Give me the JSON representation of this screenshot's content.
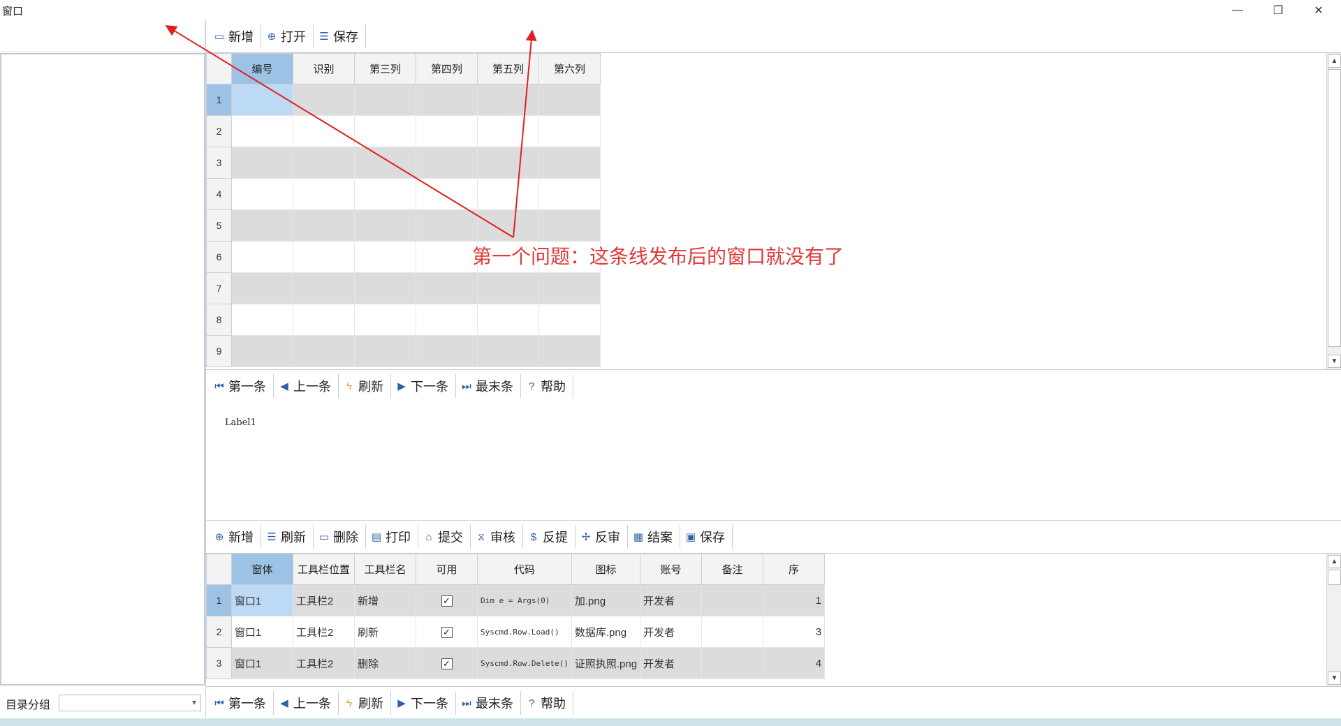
{
  "window": {
    "title": "窗口",
    "minimize": "—",
    "restore": "❐",
    "close": "✕"
  },
  "left": {
    "group_label": "目录分组",
    "combo_value": ""
  },
  "top_toolbar": [
    {
      "name": "add",
      "label": "新增",
      "icon": "▭"
    },
    {
      "name": "open",
      "label": "打开",
      "icon": "⊕"
    },
    {
      "name": "save",
      "label": "保存",
      "icon": "☰"
    }
  ],
  "grid1": {
    "columns": [
      "编号",
      "识别",
      "第三列",
      "第四列",
      "第五列",
      "第六列"
    ],
    "rows": [
      "1",
      "2",
      "3",
      "4",
      "5",
      "6",
      "7",
      "8",
      "9"
    ]
  },
  "nav_toolbar": [
    {
      "name": "first",
      "label": "第一条",
      "icon": "⏮"
    },
    {
      "name": "prev",
      "label": "上一条",
      "icon": "◀"
    },
    {
      "name": "refresh",
      "label": "刷新",
      "icon": "ϟ"
    },
    {
      "name": "next",
      "label": "下一条",
      "icon": "▶"
    },
    {
      "name": "last",
      "label": "最末条",
      "icon": "⏭"
    },
    {
      "name": "help",
      "label": "帮助",
      "icon": "?"
    }
  ],
  "label_panel": {
    "text": "Label1"
  },
  "annotation": {
    "text": "第一个问题：这条线发布后的窗口就没有了"
  },
  "bottom_toolbar": [
    {
      "name": "add",
      "label": "新增",
      "icon": "⊕"
    },
    {
      "name": "refresh",
      "label": "刷新",
      "icon": "☰"
    },
    {
      "name": "delete",
      "label": "删除",
      "icon": "▭"
    },
    {
      "name": "print",
      "label": "打印",
      "icon": "▤"
    },
    {
      "name": "submit",
      "label": "提交",
      "icon": "⌂"
    },
    {
      "name": "audit",
      "label": "审核",
      "icon": "⧖"
    },
    {
      "name": "withdraw",
      "label": "反提",
      "icon": "$"
    },
    {
      "name": "unaudit",
      "label": "反审",
      "icon": "✢"
    },
    {
      "name": "close-case",
      "label": "结案",
      "icon": "▦"
    },
    {
      "name": "save",
      "label": "保存",
      "icon": "▣"
    }
  ],
  "grid2": {
    "columns": [
      "窗体",
      "工具栏位置",
      "工具栏名",
      "可用",
      "代码",
      "图标",
      "账号",
      "备注",
      "序"
    ],
    "rows": [
      {
        "num": "1",
        "form": "窗口1",
        "pos": "工具栏2",
        "name": "新增",
        "enabled": "✓",
        "code": "Dim e = Args(0)",
        "icon": "加.png",
        "account": "开发者",
        "note": "",
        "seq": "1"
      },
      {
        "num": "2",
        "form": "窗口1",
        "pos": "工具栏2",
        "name": "刷新",
        "enabled": "✓",
        "code": "Syscmd.Row.Load()",
        "icon": "数据库.png",
        "account": "开发者",
        "note": "",
        "seq": "3"
      },
      {
        "num": "3",
        "form": "窗口1",
        "pos": "工具栏2",
        "name": "删除",
        "enabled": "✓",
        "code": "Syscmd.Row.Delete()",
        "icon": "证照执照.png",
        "account": "开发者",
        "note": "",
        "seq": "4"
      }
    ]
  }
}
